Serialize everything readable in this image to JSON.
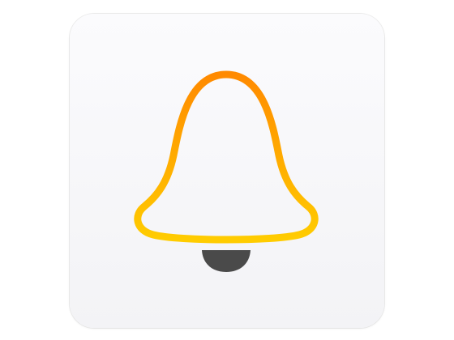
{
  "app_icon": {
    "icon": "bell-icon",
    "colors": {
      "tile_background": "#f5f5f8",
      "bell_gradient_top": "#ff8a00",
      "bell_gradient_bottom": "#ffcc00",
      "clapper": "#4a4a4a"
    }
  }
}
